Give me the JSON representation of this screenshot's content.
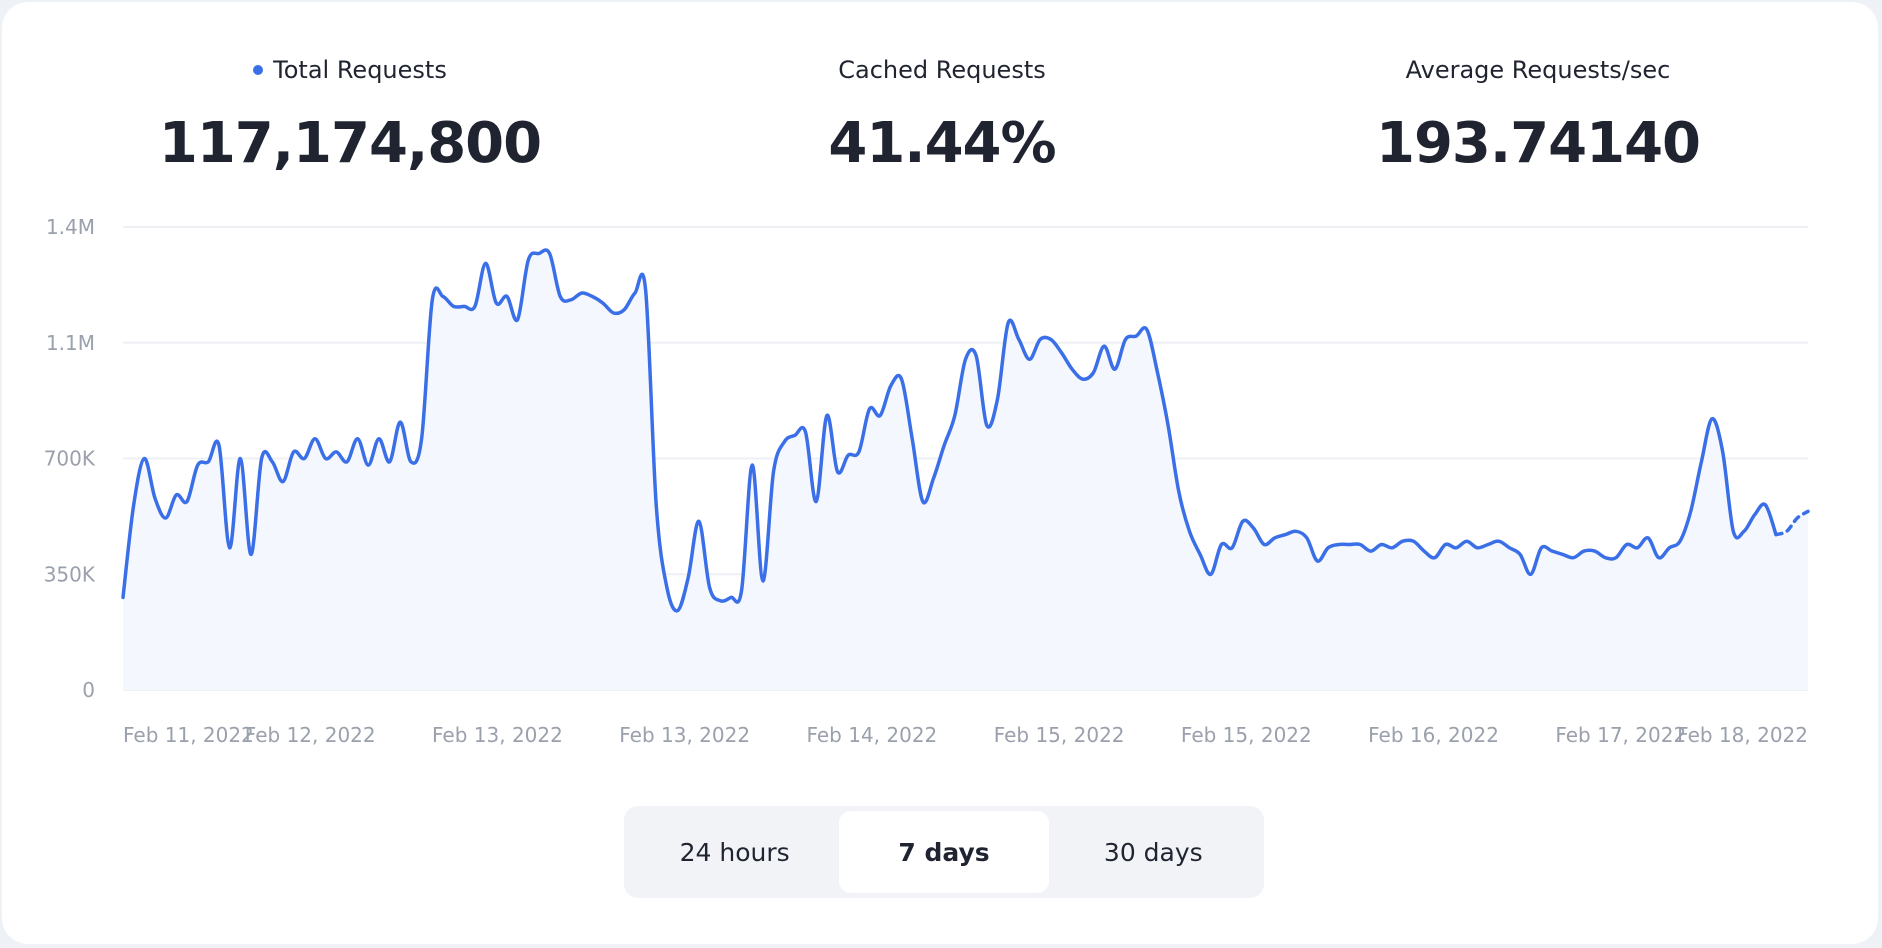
{
  "stats": {
    "total": {
      "label": "Total Requests",
      "value": "117,174,800"
    },
    "cached": {
      "label": "Cached Requests",
      "value": "41.44%"
    },
    "average": {
      "label": "Average Requests/sec",
      "value": "193.74140"
    }
  },
  "range_tabs": [
    {
      "label": "24 hours",
      "active": false
    },
    {
      "label": "7 days",
      "active": true
    },
    {
      "label": "30 days",
      "active": false
    }
  ],
  "colors": {
    "line": "#3a6fe8",
    "area": "#f4f7fd",
    "grid": "#eef0f6"
  },
  "chart_data": {
    "type": "area",
    "title": "",
    "xlabel": "",
    "ylabel": "",
    "ylim": [
      0,
      1400000
    ],
    "grid": true,
    "y_ticks": [
      {
        "value": 0,
        "label": "0"
      },
      {
        "value": 350000,
        "label": "350K"
      },
      {
        "value": 700000,
        "label": "700K"
      },
      {
        "value": 1050000,
        "label": "1.1M"
      },
      {
        "value": 1400000,
        "label": "1.4M"
      }
    ],
    "x_ticks": [
      "Feb 11, 2022",
      "Feb 12, 2022",
      "Feb 13, 2022",
      "Feb 13, 2022",
      "Feb 14, 2022",
      "Feb 15, 2022",
      "Feb 15, 2022",
      "Feb 16, 2022",
      "Feb 17, 2022",
      "Feb 18, 2022"
    ],
    "series": [
      {
        "values": [
          280000,
          560000,
          700000,
          580000,
          520000,
          590000,
          570000,
          680000,
          690000,
          740000,
          430000,
          700000,
          410000,
          700000,
          690000,
          630000,
          720000,
          700000,
          760000,
          700000,
          720000,
          690000,
          760000,
          680000,
          760000,
          690000,
          810000,
          690000,
          760000,
          1180000,
          1190000,
          1160000,
          1160000,
          1160000,
          1290000,
          1170000,
          1190000,
          1120000,
          1300000,
          1320000,
          1320000,
          1190000,
          1180000,
          1200000,
          1190000,
          1170000,
          1140000,
          1150000,
          1200000,
          1210000,
          560000,
          310000,
          240000,
          340000,
          510000,
          310000,
          270000,
          280000,
          300000,
          680000,
          330000,
          660000,
          750000,
          770000,
          780000,
          570000,
          830000,
          660000,
          710000,
          720000,
          850000,
          830000,
          920000,
          940000,
          760000,
          570000,
          640000,
          740000,
          830000,
          1000000,
          1010000,
          800000,
          880000,
          1110000,
          1060000,
          1000000,
          1060000,
          1060000,
          1020000,
          970000,
          940000,
          960000,
          1040000,
          970000,
          1060000,
          1070000,
          1090000,
          960000,
          800000,
          600000,
          480000,
          410000,
          350000,
          440000,
          430000,
          510000,
          490000,
          440000,
          460000,
          470000,
          480000,
          460000,
          390000,
          430000,
          440000,
          440000,
          440000,
          420000,
          440000,
          430000,
          450000,
          450000,
          420000,
          400000,
          440000,
          430000,
          450000,
          430000,
          440000,
          450000,
          430000,
          410000,
          350000,
          430000,
          420000,
          410000,
          400000,
          420000,
          420000,
          400000,
          400000,
          440000,
          430000,
          460000,
          400000,
          430000,
          450000,
          540000,
          690000,
          820000,
          720000,
          480000,
          480000,
          530000,
          560000,
          470000,
          480000,
          520000,
          540000
        ]
      }
    ]
  }
}
